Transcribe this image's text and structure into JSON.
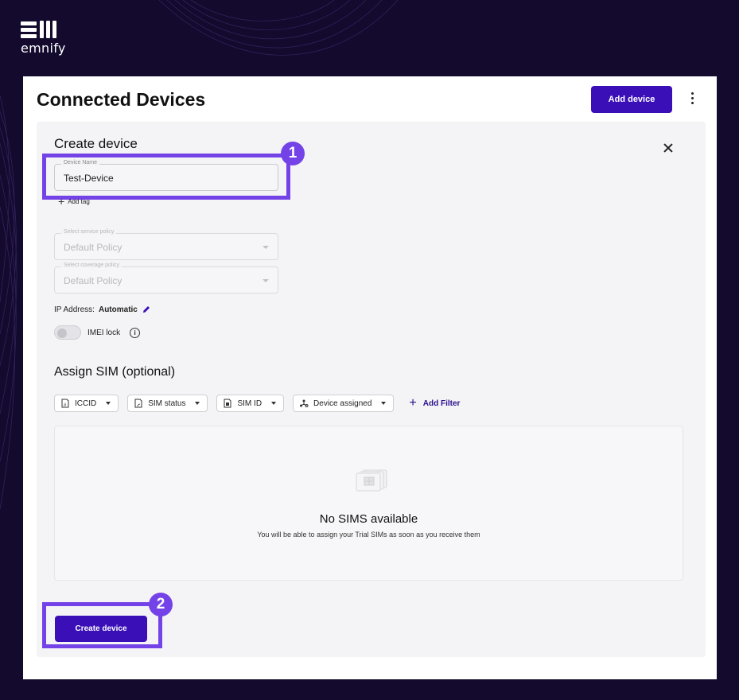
{
  "brand": {
    "name": "emnify"
  },
  "header": {
    "title": "Connected Devices",
    "add_device_label": "Add device"
  },
  "create_form": {
    "title": "Create device",
    "device_name": {
      "label": "Device Name",
      "value": "Test-Device"
    },
    "add_tag_label": "Add tag",
    "service_policy": {
      "label": "Select service policy",
      "value": "Default Policy"
    },
    "coverage_policy": {
      "label": "Select coverage policy",
      "value": "Default Policy"
    },
    "ip_address": {
      "label": "IP Address:",
      "value": "Automatic"
    },
    "imei_lock": {
      "label": "IMEI lock",
      "enabled": false
    },
    "submit_label": "Create device"
  },
  "assign_sim": {
    "title": "Assign SIM (optional)",
    "filters": [
      {
        "label": "ICCID",
        "icon": "sim-hash-icon"
      },
      {
        "label": "SIM status",
        "icon": "sim-signal-icon"
      },
      {
        "label": "SIM ID",
        "icon": "sim-card-icon"
      },
      {
        "label": "Device assigned",
        "icon": "device-network-icon"
      }
    ],
    "add_filter_label": "Add Filter",
    "empty_title": "No SIMS available",
    "empty_message": "You will be able to assign your Trial SIMs as soon as you receive them"
  },
  "annotations": [
    "1",
    "2"
  ],
  "colors": {
    "primary": "#3a0fb8",
    "highlight": "#7443e8",
    "background": "#130a2e"
  }
}
